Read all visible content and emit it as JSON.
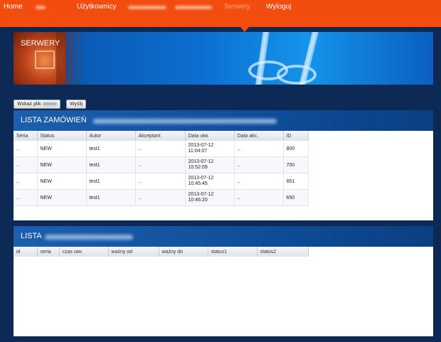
{
  "nav": {
    "home": "Home",
    "users": "Użytkownicy",
    "servers": "Serwery",
    "logout": "Wyloguj"
  },
  "banner": {
    "title": "SERWERY"
  },
  "upload": {
    "choose_label": "Wskaż plik",
    "send_label": "Wyślij"
  },
  "orders": {
    "title": "LISTA ZAMÓWIEŃ",
    "columns": [
      "Seria",
      "Status",
      "Autor",
      "Akceptant",
      "Data utw.",
      "Data akc.",
      "ID"
    ],
    "rows": [
      {
        "seria": "..",
        "status": "NEW",
        "autor": "test1",
        "akceptant": "..",
        "data_utw_date": "2013-07-12",
        "data_utw_time": "11:04:07",
        "data_akc": "..",
        "id": "800"
      },
      {
        "seria": "..",
        "status": "NEW",
        "autor": "test1",
        "akceptant": "..",
        "data_utw_date": "2013-07-12",
        "data_utw_time": "10:52:09",
        "data_akc": "..",
        "id": "700"
      },
      {
        "seria": "..",
        "status": "NEW",
        "autor": "test1",
        "akceptant": "..",
        "data_utw_date": "2013-07-12",
        "data_utw_time": "10:45:45",
        "data_akc": "..",
        "id": "651"
      },
      {
        "seria": "..",
        "status": "NEW",
        "autor": "test1",
        "akceptant": "..",
        "data_utw_date": "2013-07-12",
        "data_utw_time": "10:46:20",
        "data_akc": "..",
        "id": "650"
      }
    ]
  },
  "list2": {
    "title": "LISTA",
    "columns": [
      "id",
      "seria",
      "czas utw.",
      "ważny od",
      "ważny do",
      "status1",
      "status2"
    ]
  }
}
